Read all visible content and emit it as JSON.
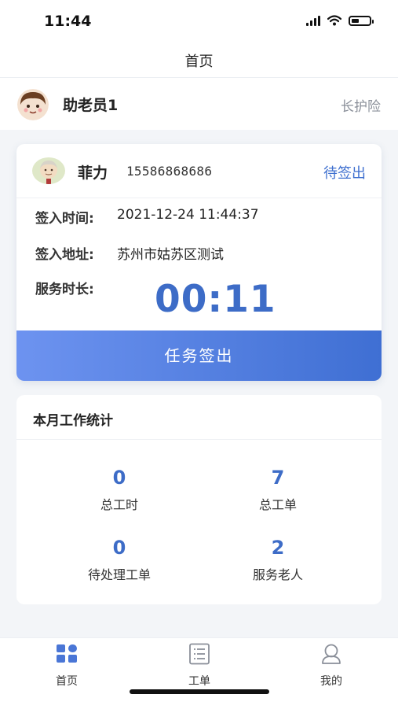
{
  "status_bar": {
    "time": "11:44"
  },
  "nav": {
    "title": "首页"
  },
  "user": {
    "name": "助老员1",
    "tag": "长护险"
  },
  "task": {
    "elder_name": "菲力",
    "elder_phone": "15586868686",
    "status": "待签出",
    "checkin_time_label": "签入时间:",
    "checkin_time_value": "2021-12-24 11:44:37",
    "checkin_address_label": "签入地址:",
    "checkin_address_value": "苏州市姑苏区测试",
    "service_duration_label": "服务时长:",
    "service_duration_value": "00:11",
    "checkout_button": "任务签出"
  },
  "stats": {
    "title": "本月工作统计",
    "items": [
      {
        "value": "0",
        "label": "总工时"
      },
      {
        "value": "7",
        "label": "总工单"
      },
      {
        "value": "0",
        "label": "待处理工单"
      },
      {
        "value": "2",
        "label": "服务老人"
      }
    ]
  },
  "tabs": [
    {
      "label": "首页",
      "icon": "home-grid-icon",
      "active": true
    },
    {
      "label": "工单",
      "icon": "list-icon",
      "active": false
    },
    {
      "label": "我的",
      "icon": "person-icon",
      "active": false
    }
  ],
  "colors": {
    "accent": "#3d6cc7",
    "button_start": "#6d93f0",
    "button_end": "#3f6fd3"
  }
}
